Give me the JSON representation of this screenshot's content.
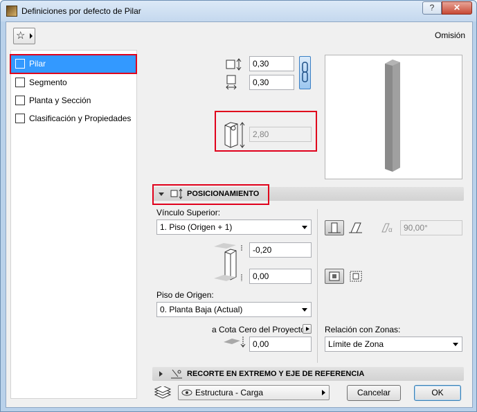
{
  "window": {
    "title": "Definiciones por defecto de Pilar",
    "help_label": "?",
    "close_label": "✕"
  },
  "header": {
    "favorites_icon": "star-icon",
    "omision_label": "Omisión"
  },
  "sidebar": {
    "items": [
      {
        "label": "Pilar",
        "icon": "column-icon",
        "active": true
      },
      {
        "label": "Segmento",
        "icon": "segment-icon",
        "active": false
      },
      {
        "label": "Planta y Sección",
        "icon": "floor-plan-icon",
        "active": false
      },
      {
        "label": "Clasificación y Propiedades",
        "icon": "classification-icon",
        "active": false
      }
    ]
  },
  "dimensions": {
    "width_value": "0,30",
    "depth_value": "0,30",
    "height_value": "2,80"
  },
  "positioning": {
    "section_title": "POSICIONAMIENTO",
    "top_link_label": "Vínculo Superior:",
    "top_link_value": "1. Piso (Origen + 1)",
    "top_offset_value": "-0,20",
    "bottom_offset_value": "0,00",
    "home_story_label": "Piso de Origen:",
    "home_story_value": "0. Planta Baja (Actual)",
    "project_zero_label": "a Cota Cero del Proyecto",
    "project_zero_value": "0,00",
    "angle_value": "90,00°",
    "zones_label": "Relación con Zonas:",
    "zones_value": "Límite de Zona"
  },
  "cut_section": {
    "title": "RECORTE EN EXTREMO Y EJE DE REFERENCIA"
  },
  "footer": {
    "layer_value": "Estructura - Carga",
    "cancel_label": "Cancelar",
    "ok_label": "OK"
  }
}
